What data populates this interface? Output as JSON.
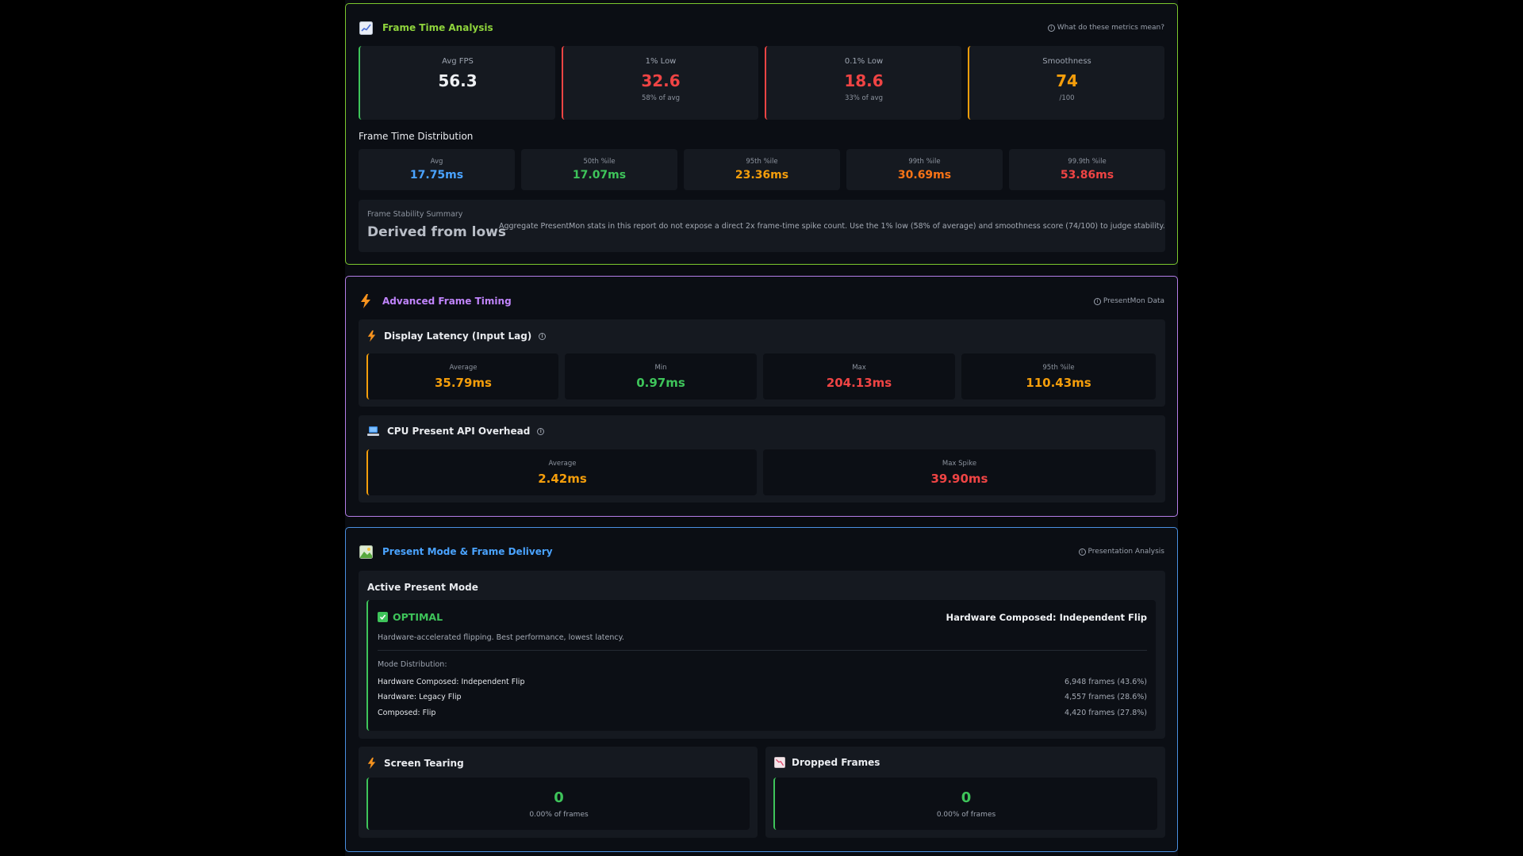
{
  "colors": {
    "green": "#3ec45a",
    "red": "#ef4444",
    "orange": "#f59e0b",
    "blue": "#4aa3ff",
    "purple": "#c084fc"
  },
  "frame_time": {
    "title": "Frame Time Analysis",
    "help_text": "What do these metrics mean?",
    "metrics": [
      {
        "label": "Avg FPS",
        "value": "56.3",
        "sub": ""
      },
      {
        "label": "1% Low",
        "value": "32.6",
        "sub": "58% of avg"
      },
      {
        "label": "0.1% Low",
        "value": "18.6",
        "sub": "33% of avg"
      },
      {
        "label": "Smoothness",
        "value": "74",
        "sub": "/100"
      }
    ],
    "distribution_title": "Frame Time Distribution",
    "distribution": [
      {
        "label": "Avg",
        "value": "17.75ms"
      },
      {
        "label": "50th %ile",
        "value": "17.07ms"
      },
      {
        "label": "95th %ile",
        "value": "23.36ms"
      },
      {
        "label": "99th %ile",
        "value": "30.69ms"
      },
      {
        "label": "99.9th %ile",
        "value": "53.86ms"
      }
    ],
    "stability": {
      "label": "Frame Stability Summary",
      "value": "Derived from lows",
      "text": "Aggregate PresentMon stats in this report do not expose a direct 2x frame-time spike count. Use the 1% low (58% of average) and smoothness score (74/100) to judge stability."
    }
  },
  "advanced": {
    "title": "Advanced Frame Timing",
    "tag": "PresentMon Data",
    "latency": {
      "title": "Display Latency (Input Lag)",
      "stats": [
        {
          "label": "Average",
          "value": "35.79ms"
        },
        {
          "label": "Min",
          "value": "0.97ms"
        },
        {
          "label": "Max",
          "value": "204.13ms"
        },
        {
          "label": "95th %ile",
          "value": "110.43ms"
        }
      ]
    },
    "cpu": {
      "title": "CPU Present API Overhead",
      "stats": [
        {
          "label": "Average",
          "value": "2.42ms"
        },
        {
          "label": "Max Spike",
          "value": "39.90ms"
        }
      ]
    }
  },
  "present": {
    "title": "Present Mode & Frame Delivery",
    "tag": "Presentation Analysis",
    "active_title": "Active Present Mode",
    "status": "OPTIMAL",
    "mode_name": "Hardware Composed: Independent Flip",
    "description": "Hardware-accelerated flipping. Best performance, lowest latency.",
    "dist_title": "Mode Distribution:",
    "modes": [
      {
        "name": "Hardware Composed: Independent Flip",
        "frames": "6,948 frames (43.6%)"
      },
      {
        "name": "Hardware: Legacy Flip",
        "frames": "4,557 frames (28.6%)"
      },
      {
        "name": "Composed: Flip",
        "frames": "4,420 frames (27.8%)"
      }
    ],
    "tearing": {
      "title": "Screen Tearing",
      "value": "0",
      "sub": "0.00% of frames"
    },
    "dropped": {
      "title": "Dropped Frames",
      "value": "0",
      "sub": "0.00% of frames"
    }
  }
}
